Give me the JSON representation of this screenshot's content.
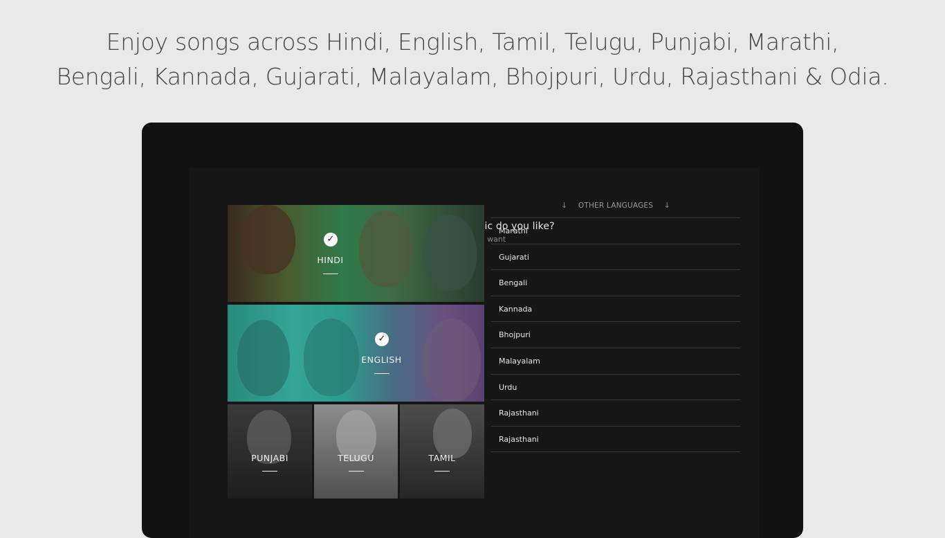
{
  "headline": {
    "line1": "Enjoy songs across Hindi, English, Tamil, Telugu, Punjabi, Marathi,",
    "line2": "Bengali, Kannada, Gujarati, Malayalam, Bhojpuri, Urdu, Rajasthani & Odia."
  },
  "onboarding": {
    "question": "What kinds of music do you like?",
    "subtitle": "Pick all you want"
  },
  "tiles": {
    "hindi": {
      "label": "HINDI",
      "selected": true
    },
    "english": {
      "label": "ENGLISH",
      "selected": true
    },
    "punjabi": {
      "label": "PUNJABI",
      "selected": false
    },
    "telugu": {
      "label": "TELUGU",
      "selected": false
    },
    "tamil": {
      "label": "TAMIL",
      "selected": false
    }
  },
  "other_languages": {
    "header": "OTHER LANGUAGES",
    "icon": "arrow-down-icon",
    "items": [
      "Marathi",
      "Gujarati",
      "Bengali",
      "Kannada",
      "Bhojpuri",
      "Malayalam",
      "Urdu",
      "Rajasthani",
      "Rajasthani"
    ]
  },
  "colors": {
    "page_bg": "#e9e9e9",
    "device_bg": "#121212",
    "text_light": "#e8e8e8"
  }
}
